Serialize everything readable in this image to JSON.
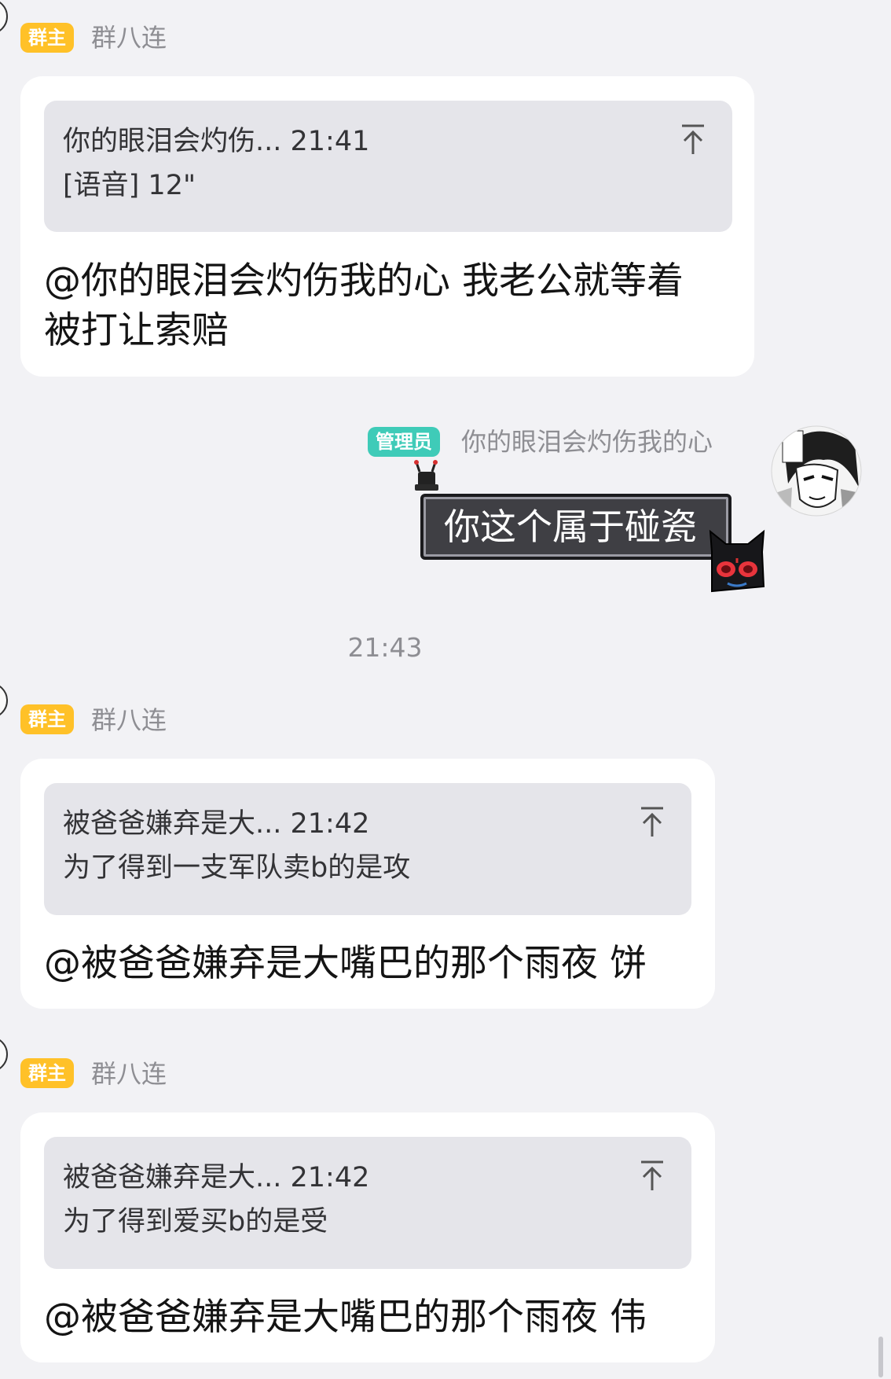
{
  "colors": {
    "background": "#f2f2f5",
    "owner_badge": "#ffc128",
    "admin_badge": "#3fcbb8",
    "bubble": "#ffffff",
    "quote_bg": "#e5e5ea",
    "meta_text": "#8e8e93"
  },
  "messages": [
    {
      "badge": "群主",
      "sender": "群八连",
      "quote": {
        "line1": "你的眼泪会灼伤... 21:41",
        "line2": "[语音] 12\""
      },
      "text_line1": "@你的眼泪会灼伤我的心 我老公就等着",
      "text_line2": "被打让索赔"
    },
    {
      "badge": "管理员",
      "sender": "你的眼泪会灼伤我的心",
      "text": "你这个属于碰瓷",
      "avatar_icon": "manga-character-avatar-icon"
    },
    {
      "badge": "群主",
      "sender": "群八连",
      "quote": {
        "line1": "被爸爸嫌弃是大... 21:42",
        "line2": "为了得到一支军队卖b的是攻"
      },
      "text": "@被爸爸嫌弃是大嘴巴的那个雨夜 饼"
    },
    {
      "badge": "群主",
      "sender": "群八连",
      "quote": {
        "line1": "被爸爸嫌弃是大... 21:42",
        "line2": "为了得到爱买b的是受"
      },
      "text": "@被爸爸嫌弃是大嘴巴的那个雨夜 伟"
    }
  ],
  "timestamp": "21:43"
}
